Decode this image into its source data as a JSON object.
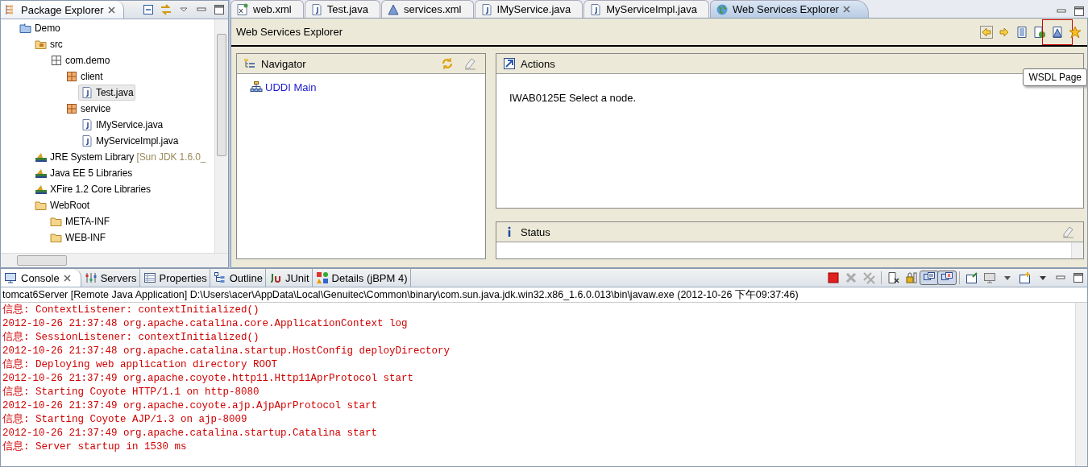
{
  "package_explorer": {
    "title": "Package Explorer",
    "tree": [
      {
        "label": "Demo",
        "kind": "project",
        "selected": false,
        "children": [
          {
            "label": "src",
            "kind": "source-folder",
            "selected": false,
            "children": [
              {
                "label": "com.demo",
                "kind": "package-empty",
                "selected": false,
                "children": [
                  {
                    "label": "client",
                    "kind": "package",
                    "selected": false,
                    "children": [
                      {
                        "label": "Test.java",
                        "kind": "java-file",
                        "selected": true
                      }
                    ]
                  },
                  {
                    "label": "service",
                    "kind": "package",
                    "selected": false,
                    "children": [
                      {
                        "label": "IMyService.java",
                        "kind": "java-file",
                        "selected": false
                      },
                      {
                        "label": "MyServiceImpl.java",
                        "kind": "java-file",
                        "selected": false
                      }
                    ]
                  }
                ]
              }
            ]
          },
          {
            "label": "JRE System Library",
            "decoration": "[Sun JDK 1.6.0_",
            "kind": "library",
            "selected": false
          },
          {
            "label": "Java EE 5 Libraries",
            "kind": "library",
            "selected": false
          },
          {
            "label": "XFire 1.2 Core Libraries",
            "kind": "library",
            "selected": false
          },
          {
            "label": "WebRoot",
            "kind": "folder",
            "selected": false,
            "children": [
              {
                "label": "META-INF",
                "kind": "folder",
                "selected": false
              },
              {
                "label": "WEB-INF",
                "kind": "folder",
                "selected": false
              }
            ]
          }
        ]
      }
    ]
  },
  "editor_tabs": [
    {
      "label": "web.xml",
      "kind": "xml",
      "selected": false
    },
    {
      "label": "Test.java",
      "kind": "java",
      "selected": false
    },
    {
      "label": "services.xml",
      "kind": "services",
      "selected": false
    },
    {
      "label": "IMyService.java",
      "kind": "java",
      "selected": false
    },
    {
      "label": "MyServiceImpl.java",
      "kind": "java",
      "selected": false
    },
    {
      "label": "Web Services Explorer",
      "kind": "globe",
      "selected": true
    }
  ],
  "web_services_explorer": {
    "title": "Web Services Explorer",
    "tooltip": "WSDL Page",
    "navigator": {
      "title": "Navigator",
      "items": [
        {
          "label": "UDDI Main"
        }
      ]
    },
    "actions": {
      "title": "Actions",
      "message": "IWAB0125E Select a node."
    },
    "status": {
      "title": "Status"
    }
  },
  "console": {
    "tabs": [
      {
        "label": "Console",
        "kind": "console",
        "selected": true
      },
      {
        "label": "Servers",
        "kind": "servers",
        "selected": false
      },
      {
        "label": "Properties",
        "kind": "properties",
        "selected": false
      },
      {
        "label": "Outline",
        "kind": "outline",
        "selected": false
      },
      {
        "label": "JUnit",
        "kind": "junit",
        "selected": false
      },
      {
        "label": "Details (jBPM 4)",
        "kind": "details",
        "selected": false
      }
    ],
    "process": "tomcat6Server [Remote Java Application] D:\\Users\\acer\\AppData\\Local\\Genuitec\\Common\\binary\\com.sun.java.jdk.win32.x86_1.6.0.013\\bin\\javaw.exe (2012-10-26 下午09:37:46)",
    "lines": [
      "信息: ContextListener: contextInitialized()",
      "2012-10-26 21:37:48 org.apache.catalina.core.ApplicationContext log",
      "信息: SessionListener: contextInitialized()",
      "2012-10-26 21:37:48 org.apache.catalina.startup.HostConfig deployDirectory",
      "信息: Deploying web application directory ROOT",
      "2012-10-26 21:37:49 org.apache.coyote.http11.Http11AprProtocol start",
      "信息: Starting Coyote HTTP/1.1 on http-8080",
      "2012-10-26 21:37:49 org.apache.coyote.ajp.AjpAprProtocol start",
      "信息: Starting Coyote AJP/1.3 on ajp-8009",
      "2012-10-26 21:37:49 org.apache.catalina.startup.Catalina start",
      "信息: Server startup in 1530 ms"
    ]
  }
}
